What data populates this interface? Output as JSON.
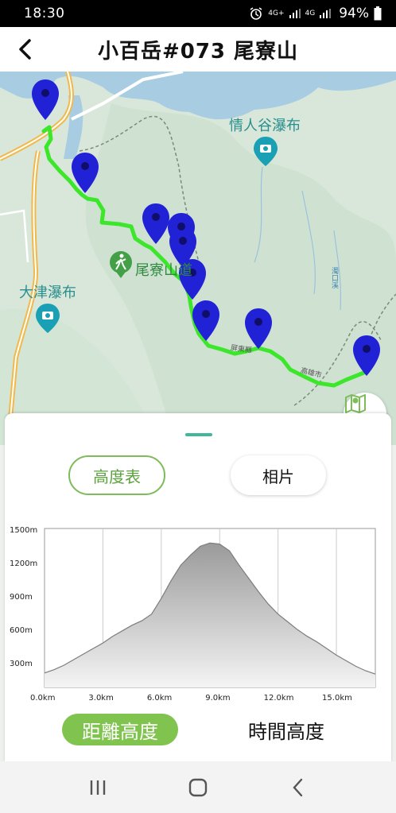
{
  "status_bar": {
    "time": "18:30",
    "net1": "4G+",
    "net2": "4G",
    "battery": "94%"
  },
  "header": {
    "title": "小百岳#073 尾寮山"
  },
  "map": {
    "labels": {
      "waterfall1": "情人谷瀑布",
      "waterfall2": "大津瀑布",
      "peak": "尾寮山",
      "peak_suffix": "道",
      "county1": "屏東縣",
      "county2": "高雄市",
      "river": "濁口溪"
    },
    "icons": [
      "pin-icon",
      "camera-icon",
      "hiker-icon",
      "map-layers-icon"
    ]
  },
  "tabs": {
    "elevation": "高度表",
    "photos": "相片"
  },
  "chart_data": {
    "type": "area",
    "xlabel": "",
    "ylabel": "",
    "x_ticks": [
      "0.0km",
      "3.0km",
      "6.0km",
      "9.0km",
      "12.0km",
      "15.0km"
    ],
    "y_ticks": [
      "300m",
      "600m",
      "900m",
      "1200m",
      "1500m"
    ],
    "xlim": [
      0,
      17
    ],
    "ylim": [
      100,
      1530
    ],
    "grid": true,
    "x": [
      0,
      0.5,
      1,
      1.5,
      2,
      2.5,
      3,
      3.5,
      4,
      4.5,
      5,
      5.5,
      6,
      6.5,
      7,
      7.5,
      8,
      8.5,
      9,
      9.5,
      10,
      10.5,
      11,
      11.5,
      12,
      12.5,
      13,
      13.5,
      14,
      14.5,
      15,
      15.5,
      16,
      16.5,
      17
    ],
    "y": [
      230,
      260,
      300,
      350,
      400,
      450,
      500,
      560,
      610,
      660,
      700,
      760,
      900,
      1060,
      1200,
      1290,
      1370,
      1400,
      1390,
      1330,
      1200,
      1080,
      960,
      850,
      760,
      690,
      620,
      560,
      510,
      450,
      390,
      340,
      290,
      250,
      220
    ],
    "fill_color": "#9a9a9a",
    "line_color": "#7d7d7d"
  },
  "modes": {
    "distance": "距離高度",
    "time": "時間高度"
  },
  "nav": {
    "recents": "recents-icon",
    "home": "home-icon",
    "back": "back-icon"
  }
}
